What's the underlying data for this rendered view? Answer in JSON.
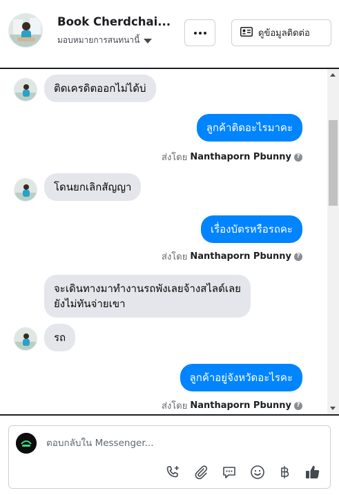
{
  "header": {
    "name": "Book Cherdchai...",
    "subtitle": "มอบหมายการสนทนานี้",
    "more_icon": "more-dots-icon",
    "contact_label": "ดูข้อมูลติดต่อ",
    "contact_icon": "contact-card-icon"
  },
  "messages": [
    {
      "direction": "in",
      "text": "ติดเครดิตออกไม่ได้บ่"
    },
    {
      "direction": "out",
      "text": "ลูกค้าติดอะไรมาคะ",
      "sent_by_prefix": "ส่งโดย",
      "sent_by_name": "Nanthaporn Pbunny"
    },
    {
      "direction": "in",
      "text": "โดนยกเลิกสัญญา"
    },
    {
      "direction": "out",
      "text": "เรื่องบัตรหรือรถคะ",
      "sent_by_prefix": "ส่งโดย",
      "sent_by_name": "Nanthaporn Pbunny"
    },
    {
      "direction": "in",
      "text_line1": "จะเดินทางมาทำงานรถพังเลยจ้างสไลด์เลย",
      "text_line2": "ยังไม่ทันจ่ายเขา"
    },
    {
      "direction": "in",
      "text": "รถ"
    },
    {
      "direction": "out",
      "text": "ลูกค้าอยู่จังหวัดอะไรคะ",
      "sent_by_prefix": "ส่งโดย",
      "sent_by_name": "Nanthaporn Pbunny"
    }
  ],
  "composer": {
    "placeholder": "ตอบกลับใน Messenger...",
    "tools": [
      "call-add-icon",
      "attachment-icon",
      "saved-reply-icon",
      "emoji-icon",
      "baht-icon",
      "like-icon"
    ]
  },
  "colors": {
    "outgoing_bubble": "#0084ff",
    "incoming_bubble": "#e4e6eb"
  }
}
